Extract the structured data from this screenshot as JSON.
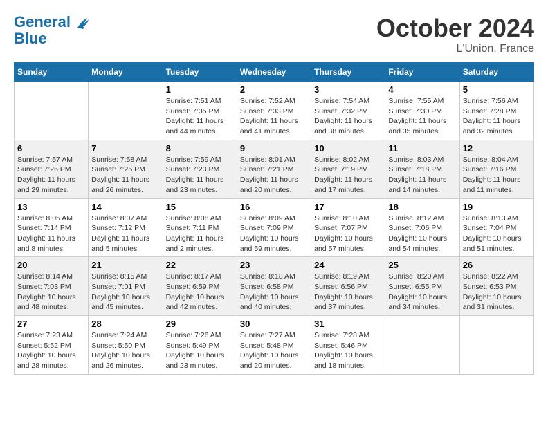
{
  "header": {
    "logo_line1": "General",
    "logo_line2": "Blue",
    "month": "October 2024",
    "location": "L'Union, France"
  },
  "weekdays": [
    "Sunday",
    "Monday",
    "Tuesday",
    "Wednesday",
    "Thursday",
    "Friday",
    "Saturday"
  ],
  "weeks": [
    [
      {
        "day": "",
        "info": ""
      },
      {
        "day": "",
        "info": ""
      },
      {
        "day": "1",
        "info": "Sunrise: 7:51 AM\nSunset: 7:35 PM\nDaylight: 11 hours\nand 44 minutes."
      },
      {
        "day": "2",
        "info": "Sunrise: 7:52 AM\nSunset: 7:33 PM\nDaylight: 11 hours\nand 41 minutes."
      },
      {
        "day": "3",
        "info": "Sunrise: 7:54 AM\nSunset: 7:32 PM\nDaylight: 11 hours\nand 38 minutes."
      },
      {
        "day": "4",
        "info": "Sunrise: 7:55 AM\nSunset: 7:30 PM\nDaylight: 11 hours\nand 35 minutes."
      },
      {
        "day": "5",
        "info": "Sunrise: 7:56 AM\nSunset: 7:28 PM\nDaylight: 11 hours\nand 32 minutes."
      }
    ],
    [
      {
        "day": "6",
        "info": "Sunrise: 7:57 AM\nSunset: 7:26 PM\nDaylight: 11 hours\nand 29 minutes."
      },
      {
        "day": "7",
        "info": "Sunrise: 7:58 AM\nSunset: 7:25 PM\nDaylight: 11 hours\nand 26 minutes."
      },
      {
        "day": "8",
        "info": "Sunrise: 7:59 AM\nSunset: 7:23 PM\nDaylight: 11 hours\nand 23 minutes."
      },
      {
        "day": "9",
        "info": "Sunrise: 8:01 AM\nSunset: 7:21 PM\nDaylight: 11 hours\nand 20 minutes."
      },
      {
        "day": "10",
        "info": "Sunrise: 8:02 AM\nSunset: 7:19 PM\nDaylight: 11 hours\nand 17 minutes."
      },
      {
        "day": "11",
        "info": "Sunrise: 8:03 AM\nSunset: 7:18 PM\nDaylight: 11 hours\nand 14 minutes."
      },
      {
        "day": "12",
        "info": "Sunrise: 8:04 AM\nSunset: 7:16 PM\nDaylight: 11 hours\nand 11 minutes."
      }
    ],
    [
      {
        "day": "13",
        "info": "Sunrise: 8:05 AM\nSunset: 7:14 PM\nDaylight: 11 hours\nand 8 minutes."
      },
      {
        "day": "14",
        "info": "Sunrise: 8:07 AM\nSunset: 7:12 PM\nDaylight: 11 hours\nand 5 minutes."
      },
      {
        "day": "15",
        "info": "Sunrise: 8:08 AM\nSunset: 7:11 PM\nDaylight: 11 hours\nand 2 minutes."
      },
      {
        "day": "16",
        "info": "Sunrise: 8:09 AM\nSunset: 7:09 PM\nDaylight: 10 hours\nand 59 minutes."
      },
      {
        "day": "17",
        "info": "Sunrise: 8:10 AM\nSunset: 7:07 PM\nDaylight: 10 hours\nand 57 minutes."
      },
      {
        "day": "18",
        "info": "Sunrise: 8:12 AM\nSunset: 7:06 PM\nDaylight: 10 hours\nand 54 minutes."
      },
      {
        "day": "19",
        "info": "Sunrise: 8:13 AM\nSunset: 7:04 PM\nDaylight: 10 hours\nand 51 minutes."
      }
    ],
    [
      {
        "day": "20",
        "info": "Sunrise: 8:14 AM\nSunset: 7:03 PM\nDaylight: 10 hours\nand 48 minutes."
      },
      {
        "day": "21",
        "info": "Sunrise: 8:15 AM\nSunset: 7:01 PM\nDaylight: 10 hours\nand 45 minutes."
      },
      {
        "day": "22",
        "info": "Sunrise: 8:17 AM\nSunset: 6:59 PM\nDaylight: 10 hours\nand 42 minutes."
      },
      {
        "day": "23",
        "info": "Sunrise: 8:18 AM\nSunset: 6:58 PM\nDaylight: 10 hours\nand 40 minutes."
      },
      {
        "day": "24",
        "info": "Sunrise: 8:19 AM\nSunset: 6:56 PM\nDaylight: 10 hours\nand 37 minutes."
      },
      {
        "day": "25",
        "info": "Sunrise: 8:20 AM\nSunset: 6:55 PM\nDaylight: 10 hours\nand 34 minutes."
      },
      {
        "day": "26",
        "info": "Sunrise: 8:22 AM\nSunset: 6:53 PM\nDaylight: 10 hours\nand 31 minutes."
      }
    ],
    [
      {
        "day": "27",
        "info": "Sunrise: 7:23 AM\nSunset: 5:52 PM\nDaylight: 10 hours\nand 28 minutes."
      },
      {
        "day": "28",
        "info": "Sunrise: 7:24 AM\nSunset: 5:50 PM\nDaylight: 10 hours\nand 26 minutes."
      },
      {
        "day": "29",
        "info": "Sunrise: 7:26 AM\nSunset: 5:49 PM\nDaylight: 10 hours\nand 23 minutes."
      },
      {
        "day": "30",
        "info": "Sunrise: 7:27 AM\nSunset: 5:48 PM\nDaylight: 10 hours\nand 20 minutes."
      },
      {
        "day": "31",
        "info": "Sunrise: 7:28 AM\nSunset: 5:46 PM\nDaylight: 10 hours\nand 18 minutes."
      },
      {
        "day": "",
        "info": ""
      },
      {
        "day": "",
        "info": ""
      }
    ]
  ]
}
